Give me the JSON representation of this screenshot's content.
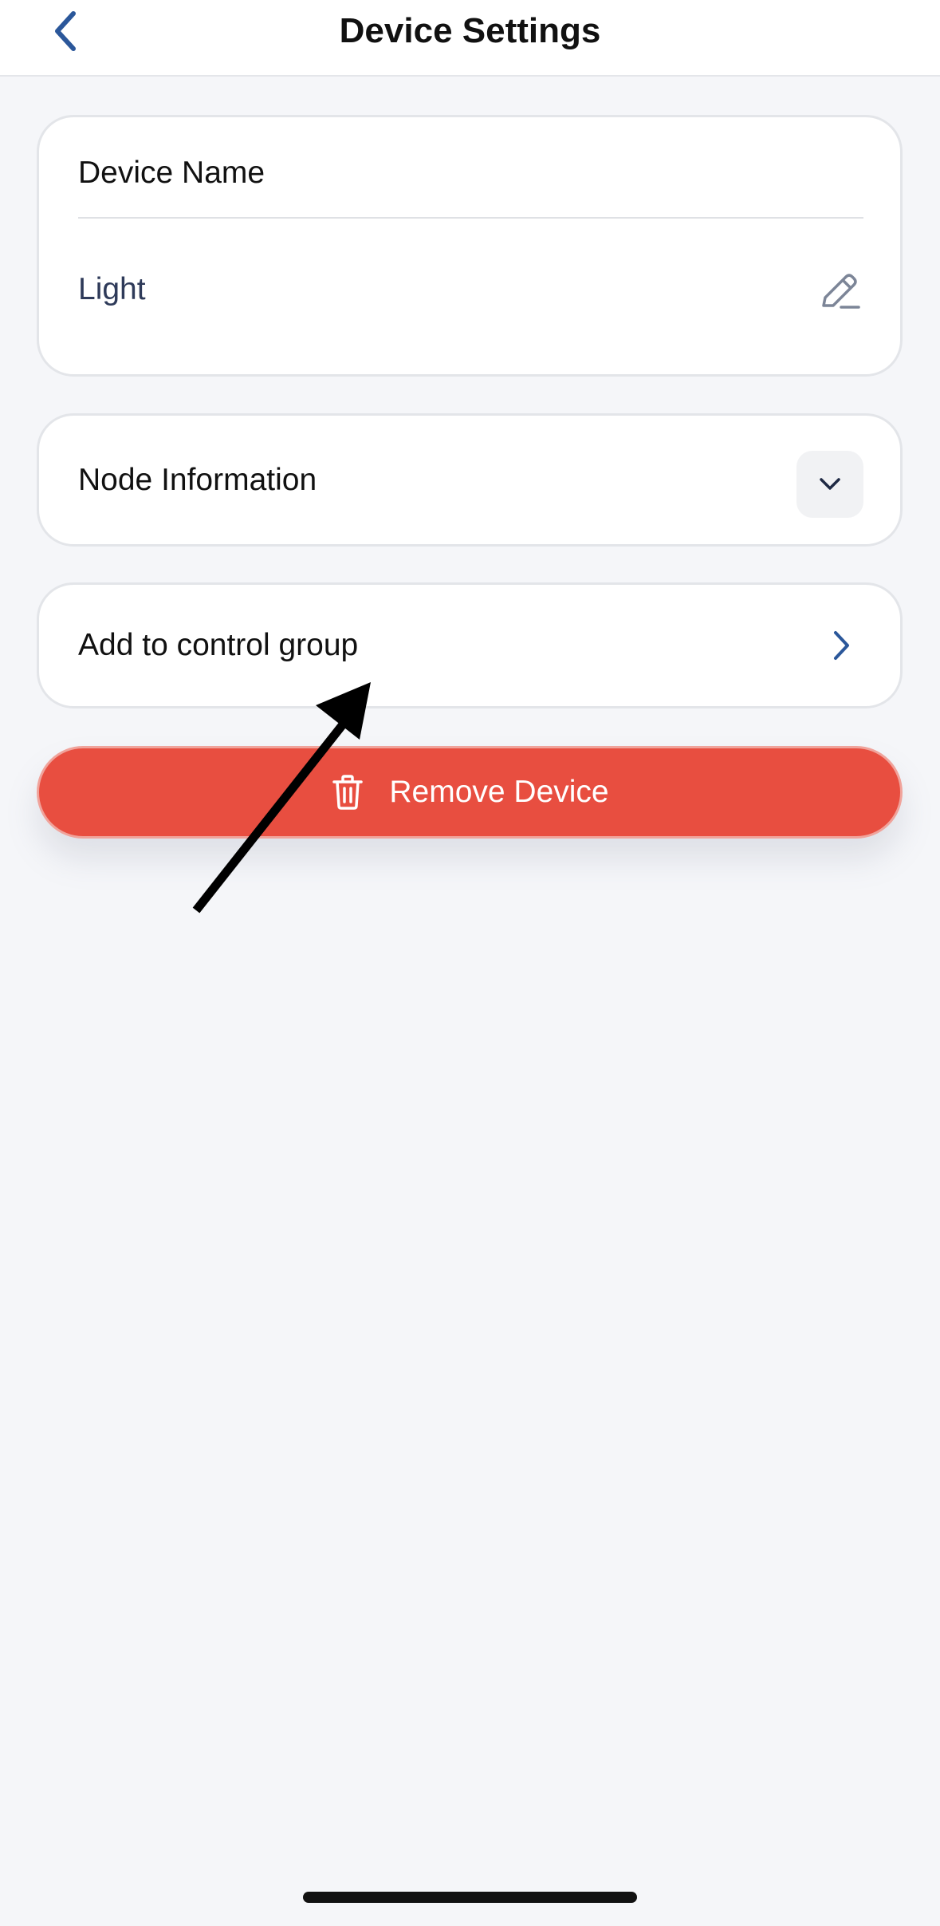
{
  "header": {
    "title": "Device Settings",
    "back_icon": "chevron-left-icon"
  },
  "device_name_card": {
    "label": "Device Name",
    "value": "Light",
    "edit_icon": "pencil-icon"
  },
  "node_info_card": {
    "label": "Node Information",
    "expand_icon": "chevron-down-icon"
  },
  "control_group_card": {
    "label": "Add to control group",
    "nav_icon": "chevron-right-icon"
  },
  "remove_button": {
    "label": "Remove Device",
    "icon": "trash-icon"
  },
  "colors": {
    "accent": "#2b579a",
    "danger": "#e84e40",
    "background": "#f5f6f9",
    "annotation_arrow": "#000000"
  }
}
